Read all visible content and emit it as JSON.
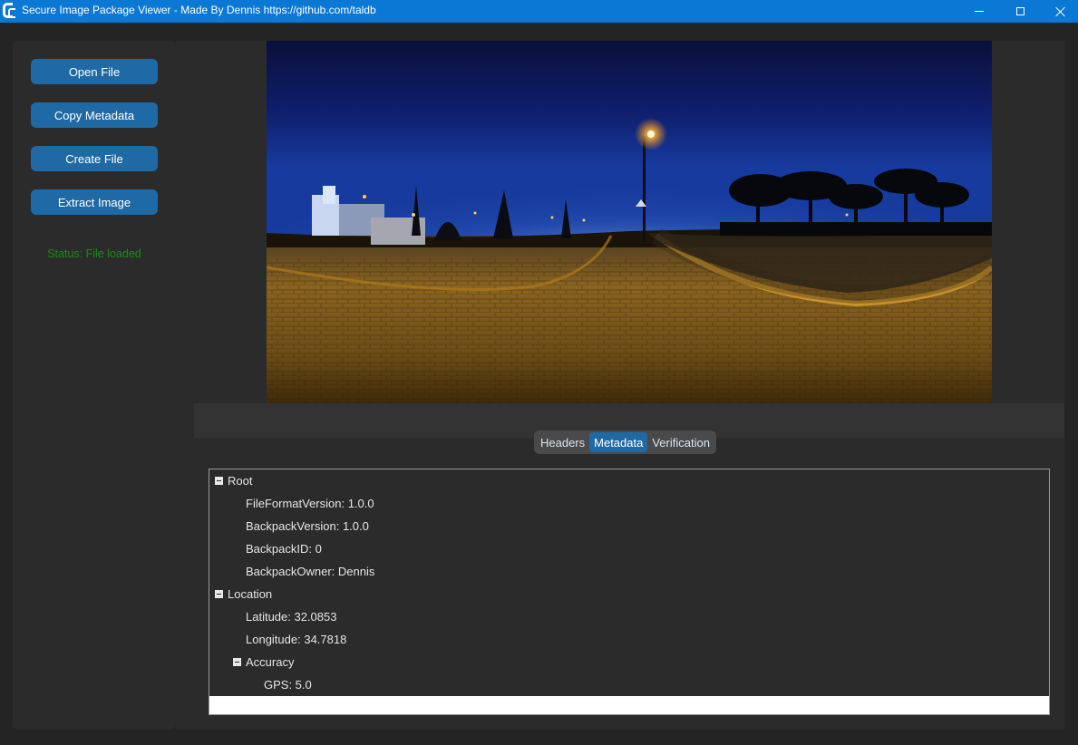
{
  "window": {
    "title": "Secure Image Package Viewer - Made By Dennis https://github.com/taldb",
    "controls": {
      "minimize": "minimize-icon",
      "maximize": "maximize-icon",
      "close": "close-icon"
    }
  },
  "sidebar": {
    "buttons": [
      {
        "label": "Open File"
      },
      {
        "label": "Copy Metadata"
      },
      {
        "label": "Create File"
      },
      {
        "label": "Extract Image"
      }
    ],
    "status": "Status: File loaded"
  },
  "tabs": {
    "items": [
      "Headers",
      "Metadata",
      "Verification"
    ],
    "active": "Metadata"
  },
  "tree": {
    "rows": [
      {
        "text": "Root",
        "level": 0,
        "expandable": true
      },
      {
        "text": "FileFormatVersion: 1.0.0",
        "level": 1,
        "expandable": false
      },
      {
        "text": "BackpackVersion: 1.0.0",
        "level": 1,
        "expandable": false
      },
      {
        "text": "BackpackID: 0",
        "level": 1,
        "expandable": false
      },
      {
        "text": "BackpackOwner: Dennis",
        "level": 1,
        "expandable": false
      },
      {
        "text": "Location",
        "level": 0,
        "expandable": true
      },
      {
        "text": "Latitude: 32.0853",
        "level": 1,
        "expandable": false
      },
      {
        "text": "Longitude: 34.7818",
        "level": 1,
        "expandable": false
      },
      {
        "text": "Accuracy",
        "level": 1,
        "expandable": true
      },
      {
        "text": "GPS: 5.0",
        "level": 2,
        "expandable": false
      }
    ]
  },
  "colors": {
    "titlebar": "#0a78d4",
    "accent": "#1f6aa5",
    "status": "#1a8a1a",
    "panel": "#2b2b2b",
    "background": "#242424"
  }
}
